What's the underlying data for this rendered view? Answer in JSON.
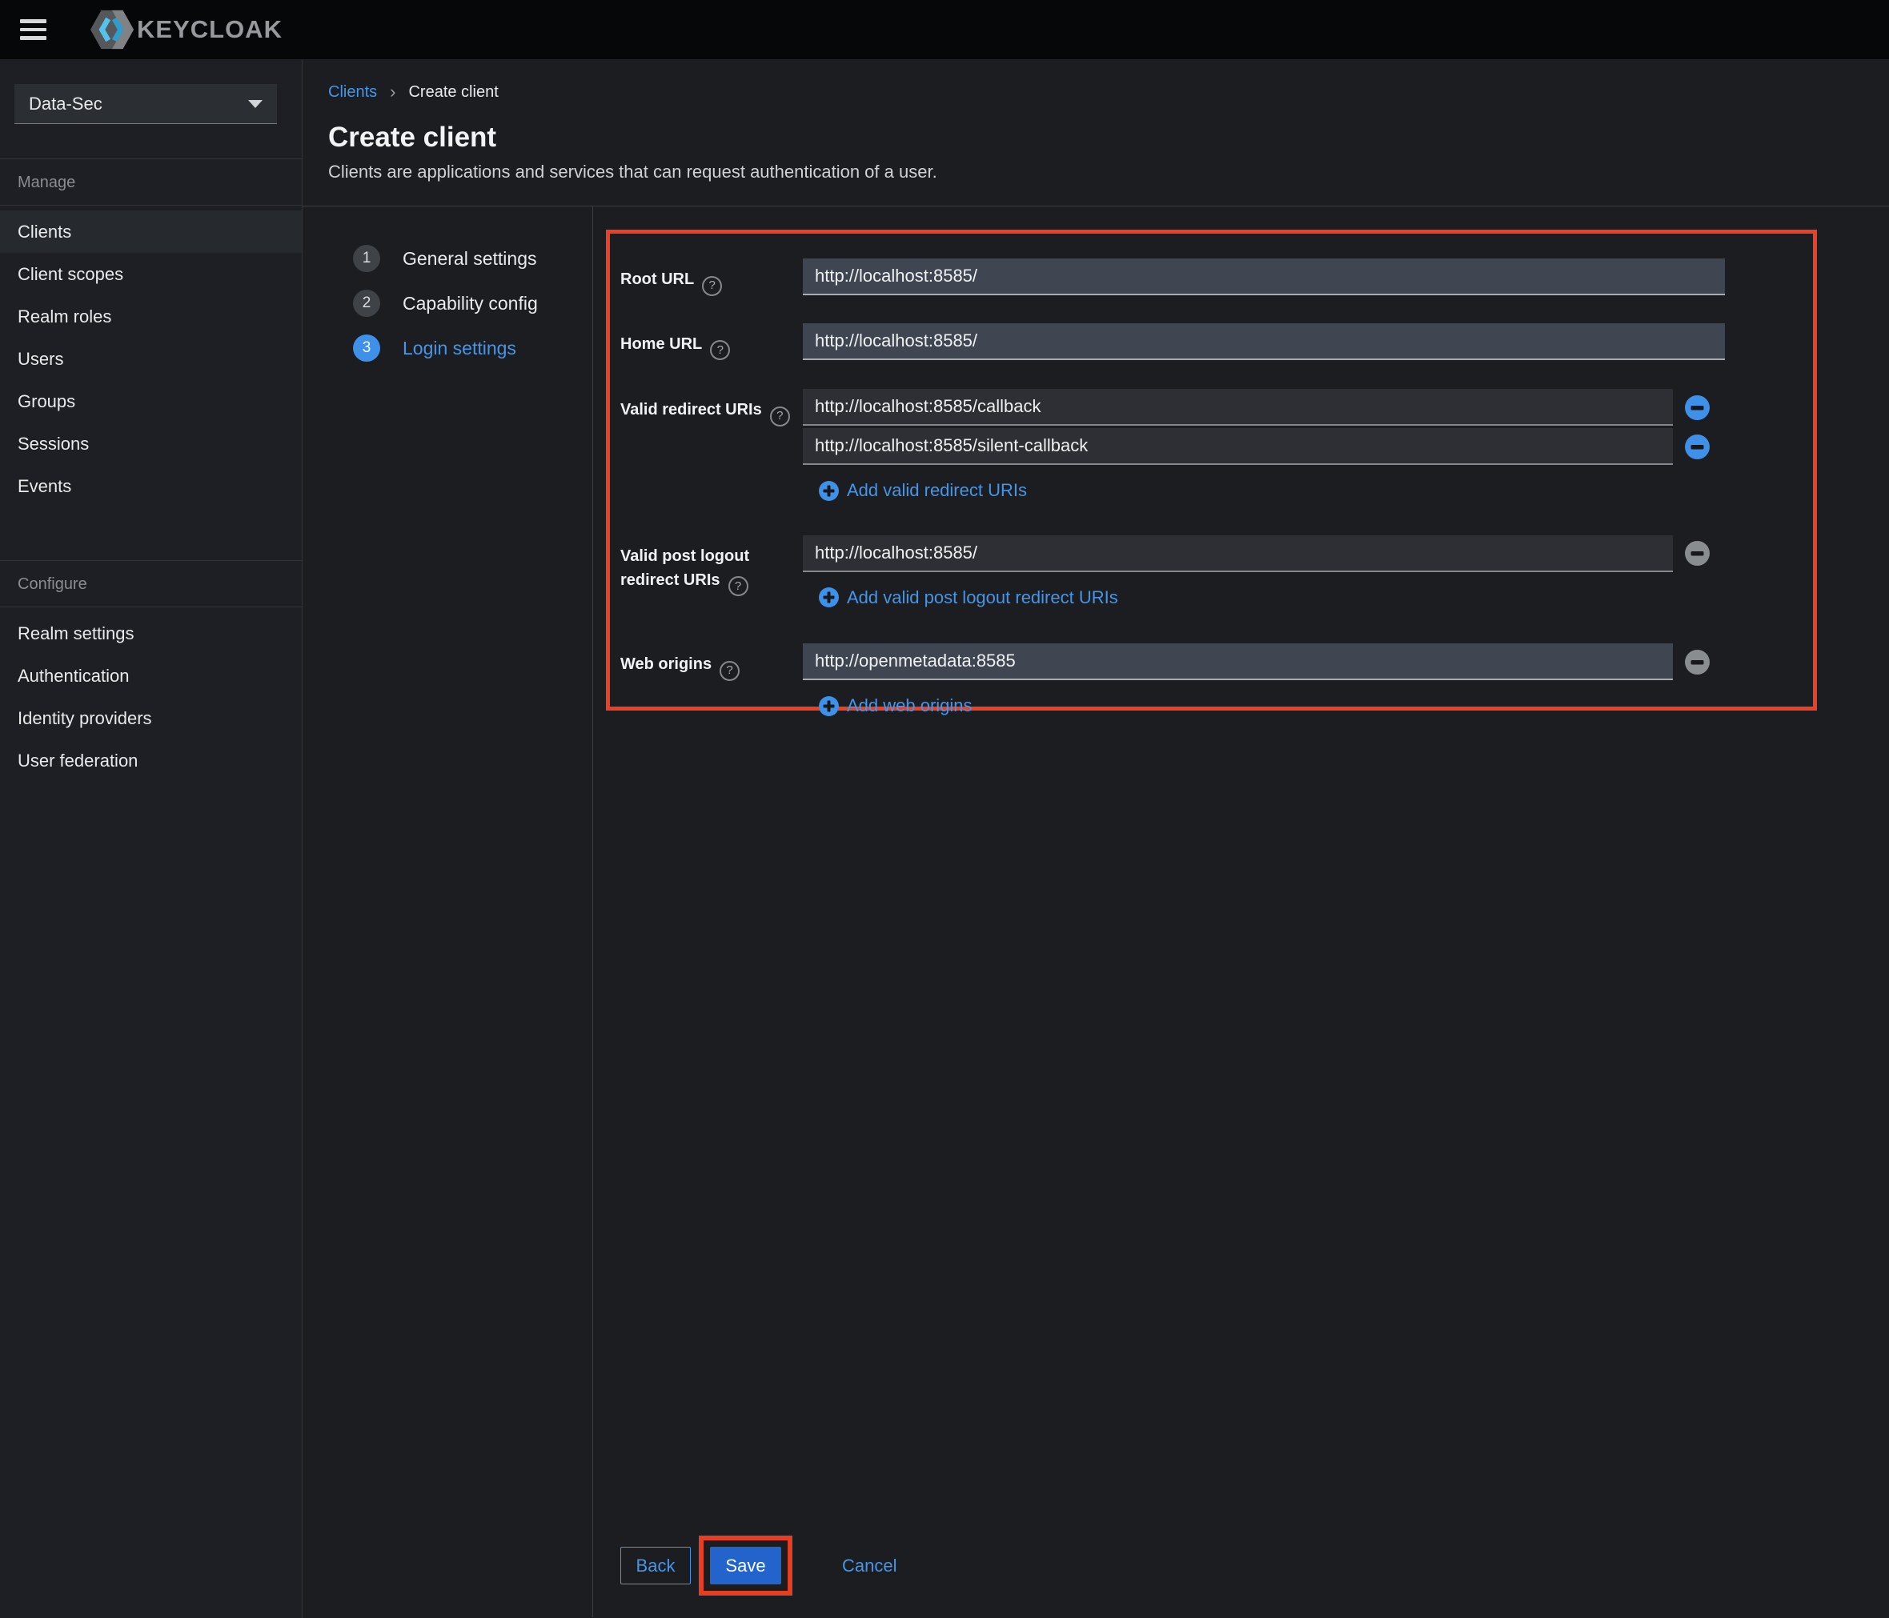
{
  "topbar": {
    "brand": "KEYCLOAK"
  },
  "sidebar": {
    "realm": "Data-Sec",
    "manage_label": "Manage",
    "manage_items": [
      "Clients",
      "Client scopes",
      "Realm roles",
      "Users",
      "Groups",
      "Sessions",
      "Events"
    ],
    "active_item": "Clients",
    "configure_label": "Configure",
    "configure_items": [
      "Realm settings",
      "Authentication",
      "Identity providers",
      "User federation"
    ]
  },
  "breadcrumb": {
    "parent": "Clients",
    "current": "Create client"
  },
  "page": {
    "title": "Create client",
    "subtitle": "Clients are applications and services that can request authentication of a user."
  },
  "wizard": {
    "steps": [
      {
        "num": "1",
        "label": "General settings"
      },
      {
        "num": "2",
        "label": "Capability config"
      },
      {
        "num": "3",
        "label": "Login settings"
      }
    ],
    "active_step": "3"
  },
  "form": {
    "root_url": {
      "label": "Root URL",
      "value": "http://localhost:8585/"
    },
    "home_url": {
      "label": "Home URL",
      "value": "http://localhost:8585/"
    },
    "redirect_uris": {
      "label": "Valid redirect URIs",
      "values": [
        "http://localhost:8585/callback",
        "http://localhost:8585/silent-callback"
      ],
      "add_label": "Add valid redirect URIs"
    },
    "post_logout": {
      "label": "Valid post logout redirect URIs",
      "value": "http://localhost:8585/",
      "add_label": "Add valid post logout redirect URIs"
    },
    "web_origins": {
      "label": "Web origins",
      "value": "http://openmetadata:8585",
      "add_label": "Add web origins"
    }
  },
  "footer": {
    "back": "Back",
    "save": "Save",
    "cancel": "Cancel"
  },
  "icons": {
    "help": "?",
    "breadcrumb_separator": "›"
  },
  "colors": {
    "highlight_red": "#ee3f25",
    "link_blue": "#4596e8",
    "primary_blue": "#2264cc",
    "minus_active_blue": "#3e90e8",
    "minus_muted_gray": "#8a8d90",
    "input_slate": "#3f4652",
    "input_dark": "#2d2f34"
  }
}
